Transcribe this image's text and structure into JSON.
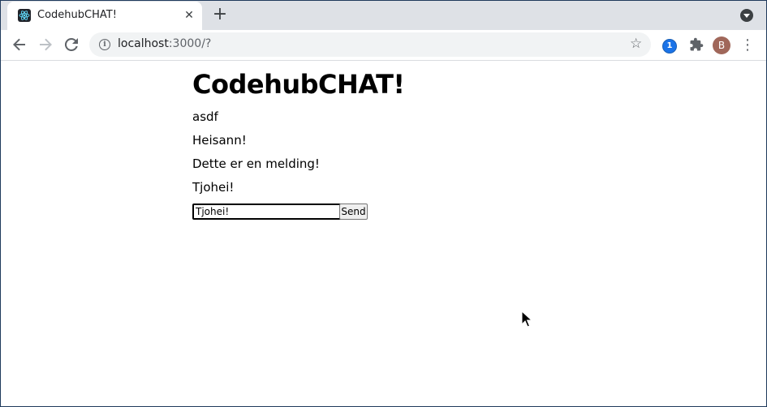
{
  "browser": {
    "tab": {
      "title": "CodehubCHAT!",
      "favicon": "react-icon",
      "close_glyph": "✕"
    },
    "new_tab_glyph": "+",
    "address_bar": {
      "host": "localhost",
      "path": ":3000/?"
    },
    "avatar_initial": "B",
    "extension_badge": "1"
  },
  "page": {
    "title": "CodehubCHAT!",
    "messages": [
      "asdf",
      "Heisann!",
      "Dette er en melding!",
      "Tjohei!"
    ],
    "input_value": "Tjohei!",
    "send_label": "Send"
  },
  "colors": {
    "tabstrip_bg": "#dee1e6",
    "omnibox_bg": "#f1f3f4",
    "avatar_bg": "#a0675a",
    "extension_blue": "#1a73e8"
  }
}
